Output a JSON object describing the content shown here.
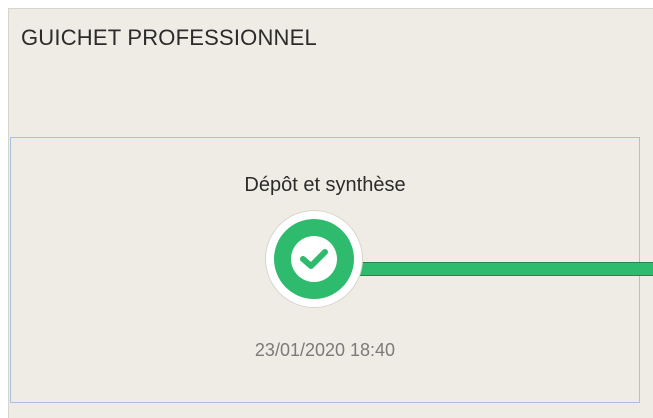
{
  "panel": {
    "title": "GUICHET PROFESSIONNEL"
  },
  "step": {
    "label": "Dépôt et synthèse",
    "date": "23/01/2020 18:40",
    "status_icon": "check-icon",
    "status": "completed"
  },
  "colors": {
    "success_green": "#2fbb6d",
    "panel_bg": "#efece5",
    "card_border": "#a9c1da",
    "text_dark": "#2b2b2b",
    "text_muted": "#7a7a7a"
  }
}
